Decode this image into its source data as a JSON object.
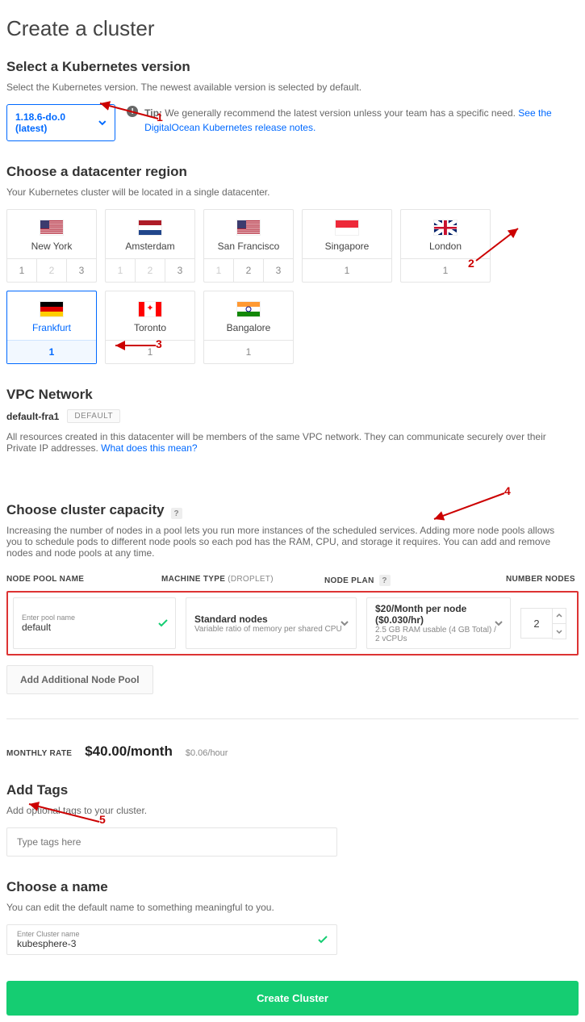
{
  "title": "Create a cluster",
  "section_version": {
    "heading": "Select a Kubernetes version",
    "sub": "Select the Kubernetes version. The newest available version is selected by default.",
    "selected": "1.18.6-do.0 (latest)",
    "tip_prefix": "Tip:",
    "tip_text": " We generally recommend the latest version unless your team has a specific need. ",
    "tip_link": "See the DigitalOcean Kubernetes release notes."
  },
  "section_region": {
    "heading": "Choose a datacenter region",
    "sub": "Your Kubernetes cluster will be located in a single datacenter.",
    "regions": [
      {
        "name": "New York",
        "flag": "us",
        "nums": [
          "1",
          "2",
          "3"
        ],
        "dis": [
          false,
          true,
          false
        ],
        "sel": false
      },
      {
        "name": "Amsterdam",
        "flag": "nl",
        "nums": [
          "1",
          "2",
          "3"
        ],
        "dis": [
          true,
          true,
          false
        ],
        "sel": false
      },
      {
        "name": "San Francisco",
        "flag": "us",
        "nums": [
          "1",
          "2",
          "3"
        ],
        "dis": [
          true,
          false,
          false
        ],
        "sel": false
      },
      {
        "name": "Singapore",
        "flag": "sg",
        "nums": [
          "1"
        ],
        "dis": [
          false
        ],
        "sel": false
      },
      {
        "name": "London",
        "flag": "uk",
        "nums": [
          "1"
        ],
        "dis": [
          false
        ],
        "sel": false
      },
      {
        "name": "Frankfurt",
        "flag": "de",
        "nums": [
          "1"
        ],
        "dis": [
          false
        ],
        "sel": true
      },
      {
        "name": "Toronto",
        "flag": "ca",
        "nums": [
          "1"
        ],
        "dis": [
          false
        ],
        "sel": false
      },
      {
        "name": "Bangalore",
        "flag": "in",
        "nums": [
          "1"
        ],
        "dis": [
          false
        ],
        "sel": false
      }
    ]
  },
  "section_vpc": {
    "heading": "VPC Network",
    "name": "default-fra1",
    "badge": "DEFAULT",
    "desc1": "All resources created in this datacenter will be members of the same VPC network. They can communicate securely over their Private IP addresses. ",
    "desc_link": "What does this mean?"
  },
  "section_capacity": {
    "heading": "Choose cluster capacity",
    "desc": "Increasing the number of nodes in a pool lets you run more instances of the scheduled services. Adding more node pools allows you to schedule pods to different node pools so each pod has the RAM, CPU, and storage it requires. You can add and remove nodes and node pools at any time.",
    "cols": {
      "a": "NODE POOL NAME",
      "b": "MACHINE TYPE ",
      "b2": "(DROPLET)",
      "c": "NODE PLAN",
      "d": "NUMBER NODES"
    },
    "pool": {
      "name_label": "Enter pool name",
      "name": "default",
      "machine": "Standard nodes",
      "machine_sub": "Variable ratio of memory per shared CPU",
      "plan": "$20/Month per node ($0.030/hr)",
      "plan_sub": "2.5 GB RAM usable (4 GB Total) / 2 vCPUs",
      "nodes": "2"
    },
    "add": "Add Additional Node Pool"
  },
  "section_rate": {
    "label": "MONTHLY RATE",
    "main": "$40.00/month",
    "sub": "$0.06/hour"
  },
  "section_tags": {
    "heading": "Add Tags",
    "sub": "Add optional tags to your cluster.",
    "placeholder": "Type tags here"
  },
  "section_name": {
    "heading": "Choose a name",
    "sub": "You can edit the default name to something meaningful to you.",
    "label": "Enter Cluster name",
    "value": "kubesphere-3"
  },
  "create": "Create Cluster",
  "annotations": {
    "a1": "1",
    "a2": "2",
    "a3": "3",
    "a4": "4",
    "a5": "5"
  }
}
